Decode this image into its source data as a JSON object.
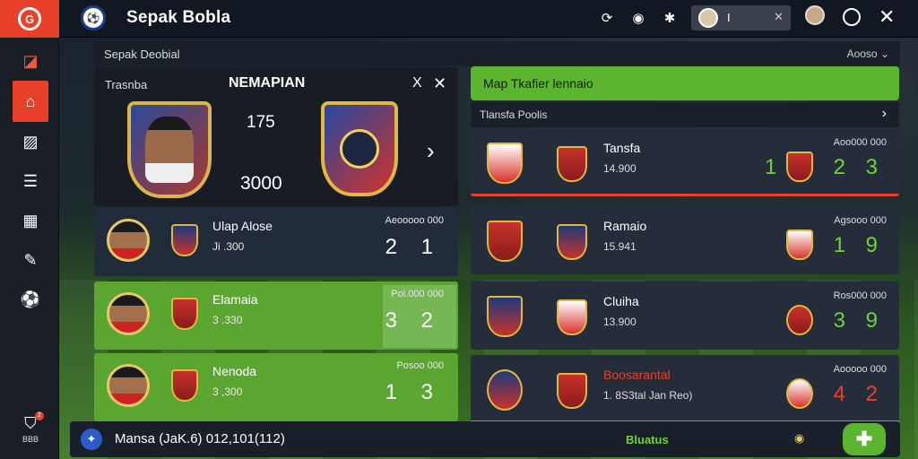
{
  "app": {
    "title": "Sepak Bobla"
  },
  "topbar": {
    "user_value": "I"
  },
  "sidebar": {
    "footer_label": "BBB",
    "footer_badge": "2"
  },
  "section": {
    "title": "Sepak Deobial",
    "right": "Aooso ⌄"
  },
  "featured": {
    "label": "Trasnba",
    "title": "NEMAPIAN",
    "num1": "175",
    "num2": "3000",
    "close1": "X",
    "close2": "✕"
  },
  "left_rows": [
    {
      "name": "Ulap Alose",
      "sub": "Ji .300",
      "small": "Aeooooo 000",
      "score": "2 1",
      "style": "dark"
    },
    {
      "name": "Elamaia",
      "sub": "3 .330",
      "small": "Pol.000 000",
      "score": "3 2",
      "style": "green"
    },
    {
      "name": "Nenoda",
      "sub": "3 ,300",
      "small": "Posoo 000",
      "score": "1 3",
      "style": "green"
    }
  ],
  "right_panel": {
    "header": "Map Tkafier lennaio",
    "sub": "Tlansfa Poolis",
    "rows": [
      {
        "name": "Tansfa",
        "sub": "14.900",
        "small": "Aoo000 000",
        "lead": "1",
        "score": "2 3",
        "score_color": "g",
        "line": "redline",
        "name_color": ""
      },
      {
        "name": "Ramaio",
        "sub": "15.941",
        "small": "Agsooo 000",
        "lead": "",
        "score": "1 9",
        "score_color": "g",
        "line": "",
        "name_color": ""
      },
      {
        "name": "Cluiha",
        "sub": "13.900",
        "small": "Ros000 000",
        "lead": "",
        "score": "3 9",
        "score_color": "g",
        "line": "",
        "name_color": ""
      },
      {
        "name": "Boosarantal",
        "sub": "1. 8S3tal Jan Reo)",
        "small": "Aooooo 000",
        "lead": "",
        "score": "4 2",
        "score_color": "r",
        "line": "greenline",
        "name_color": "red"
      }
    ]
  },
  "bottom": {
    "text": "Mansa (JaK.6) 012,101(112)",
    "status": "Bluatus"
  },
  "colors": {
    "accent": "#e8412a",
    "green": "#5bb52e",
    "panel": "#1a2029"
  }
}
